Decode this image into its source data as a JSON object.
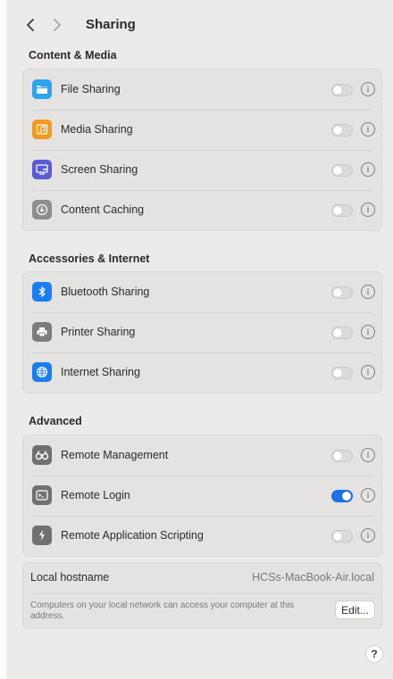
{
  "header": {
    "title": "Sharing",
    "back_icon": "chevron-left-icon",
    "forward_icon": "chevron-right-icon"
  },
  "sections": [
    {
      "title": "Content & Media",
      "items": [
        {
          "label": "File Sharing",
          "icon": "folder-icon",
          "color": "#2fa3f2",
          "enabled": false
        },
        {
          "label": "Media Sharing",
          "icon": "music-icon",
          "color": "#f29a1f",
          "enabled": false
        },
        {
          "label": "Screen Sharing",
          "icon": "display-icon",
          "color": "#5b5bd6",
          "enabled": false
        },
        {
          "label": "Content Caching",
          "icon": "download-icon",
          "color": "#8e8e8e",
          "enabled": false
        }
      ]
    },
    {
      "title": "Accessories & Internet",
      "items": [
        {
          "label": "Bluetooth Sharing",
          "icon": "bluetooth-icon",
          "color": "#1a7ef2",
          "enabled": false
        },
        {
          "label": "Printer Sharing",
          "icon": "printer-icon",
          "color": "#7c7c7c",
          "enabled": false
        },
        {
          "label": "Internet Sharing",
          "icon": "globe-icon",
          "color": "#1a7ef2",
          "enabled": false
        }
      ]
    },
    {
      "title": "Advanced",
      "items": [
        {
          "label": "Remote Management",
          "icon": "binoculars-icon",
          "color": "#707070",
          "enabled": false
        },
        {
          "label": "Remote Login",
          "icon": "terminal-icon",
          "color": "#707070",
          "enabled": true
        },
        {
          "label": "Remote Application Scripting",
          "icon": "script-icon",
          "color": "#707070",
          "enabled": false
        }
      ]
    }
  ],
  "hostname": {
    "label": "Local hostname",
    "value": "HCSs-MacBook-Air.local",
    "description": "Computers on your local network can access your computer at this address.",
    "edit_label": "Edit..."
  },
  "help_label": "?",
  "info_glyph": "i",
  "colors": {
    "toggle_on": "#1a73e8",
    "window_bg": "#ecebe9",
    "group_bg": "#e4e3e1"
  }
}
